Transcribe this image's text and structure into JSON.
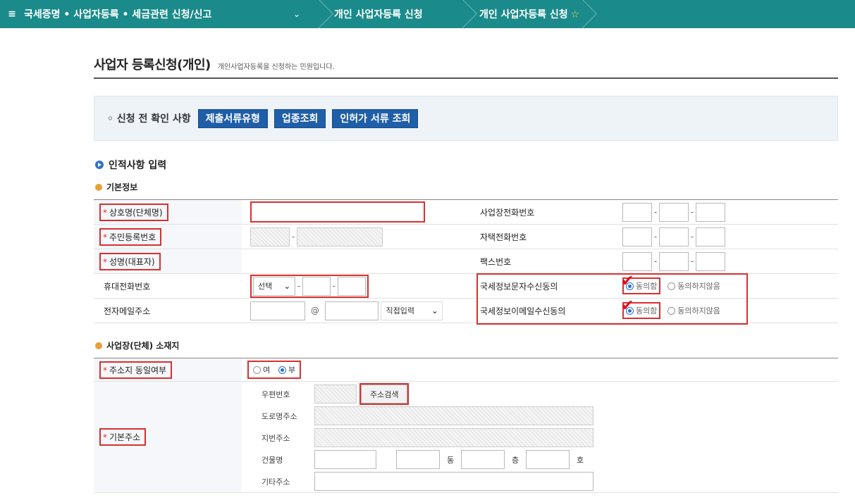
{
  "nav": {
    "menu_icon": "≡",
    "crumb1": "국세증명 • 사업자등록 • 세금관련 신청/신고",
    "crumb2": "개인 사업자등록 신청",
    "crumb3": "개인 사업자등록 신청",
    "star_icon": "☆"
  },
  "page": {
    "title": "사업자 등록신청(개인)",
    "desc": "개인사업자등록을 신청하는 민원입니다."
  },
  "precheck": {
    "label": "◦ 신청 전 확인 사항",
    "buttons": [
      "제출서류유형",
      "업종조회",
      "인허가 서류 조회"
    ]
  },
  "sections": {
    "personal": "인적사항 입력",
    "basic": "기본정보",
    "location": "사업장(단체) 소재지"
  },
  "basic_form": {
    "trade_name": "상호명(단체명)",
    "resident_no": "주민등록번호",
    "name": "성명(대표자)",
    "mobile": "휴대전화번호",
    "email": "전자메일주소",
    "biz_phone": "사업장전화번호",
    "home_phone": "자택전화번호",
    "fax": "팩스번호",
    "sms_consent": "국세정보문자수신동의",
    "email_consent": "국세정보이메일수신동의",
    "mobile_select": "선택",
    "at": "@",
    "email_domain_select": "직접입력",
    "agree": "동의함",
    "disagree": "동의하지않음"
  },
  "location_form": {
    "same_addr": "주소지 동일여부",
    "yes": "여",
    "no": "부",
    "base_addr": "기본주소",
    "postcode": "우편번호",
    "search_btn": "주소검색",
    "road_addr": "도로명주소",
    "lot_addr": "지번주소",
    "building": "건물명",
    "dong": "동",
    "floor": "층",
    "ho": "호",
    "etc_addr": "기타주소"
  }
}
